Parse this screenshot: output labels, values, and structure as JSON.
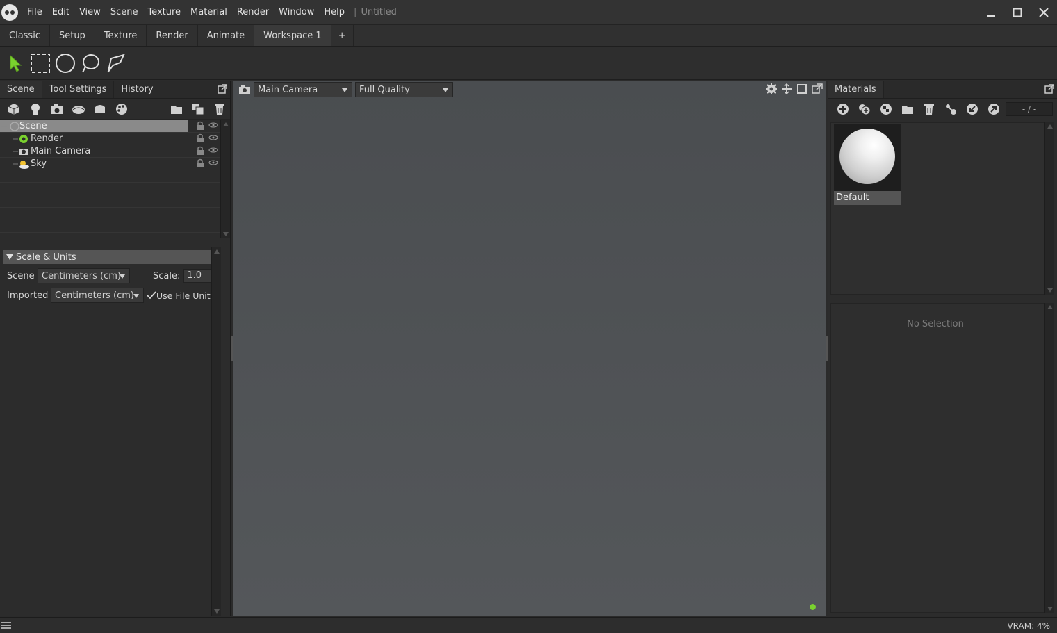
{
  "app": {
    "menu": [
      "File",
      "Edit",
      "View",
      "Scene",
      "Texture",
      "Material",
      "Render",
      "Window",
      "Help"
    ],
    "title_separator": "|",
    "document_title": "Untitled"
  },
  "workspace_tabs": [
    "Classic",
    "Setup",
    "Texture",
    "Render",
    "Animate",
    "Workspace 1"
  ],
  "workspace_add": "+",
  "left_panel": {
    "tabs": [
      "Scene",
      "Tool Settings",
      "History"
    ],
    "tree": [
      {
        "label": "Scene",
        "icon": "scene-icon"
      },
      {
        "label": "Render",
        "icon": "render-gear-icon"
      },
      {
        "label": "Main Camera",
        "icon": "camera-icon"
      },
      {
        "label": "Sky",
        "icon": "sky-icon"
      }
    ],
    "scale_section": {
      "title": "Scale & Units",
      "scene_label": "Scene",
      "scene_unit": "Centimeters (cm)",
      "scale_label": "Scale:",
      "scale_value": "1.0",
      "imported_label": "Imported",
      "imported_unit": "Centimeters (cm)",
      "use_file_units_label": "Use File Units"
    }
  },
  "viewport": {
    "camera": "Main Camera",
    "quality": "Full Quality"
  },
  "right_panel": {
    "tab": "Materials",
    "page_indicator": "- / -",
    "materials": [
      {
        "name": "Default"
      }
    ],
    "no_selection": "No Selection"
  },
  "status": {
    "vram": "VRAM: 4%"
  },
  "colors": {
    "accent_green": "#7ad12e",
    "selection_gray": "#8a8a8a",
    "viewport_bg": "#505356"
  }
}
